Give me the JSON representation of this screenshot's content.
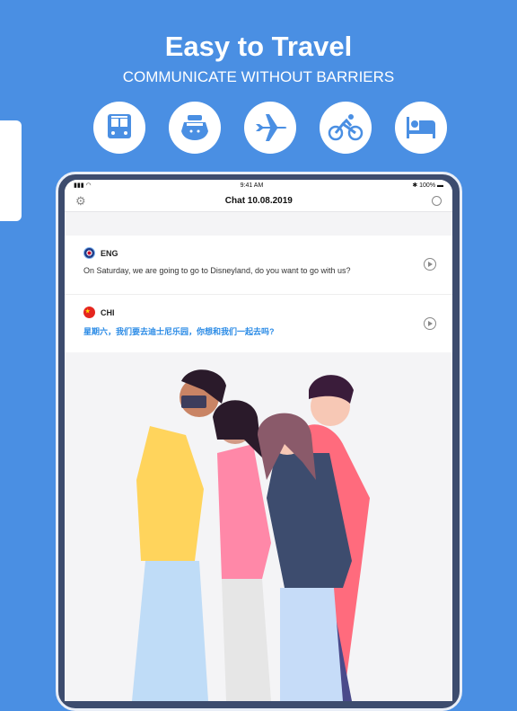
{
  "header": {
    "title": "Easy to Travel",
    "subtitle": "COMMUNICATE WITHOUT BARRIERS"
  },
  "categories": [
    "bus-icon",
    "ship-icon",
    "airplane-icon",
    "bicycle-icon",
    "bed-icon"
  ],
  "status_bar": {
    "time": "9:41 AM",
    "battery": "100%"
  },
  "nav": {
    "title": "Chat 10.08.2019"
  },
  "messages": [
    {
      "lang": "ENG",
      "text": "On Saturday, we are going to go to Disneyland, do you want to go with us?"
    },
    {
      "lang": "CHI",
      "text": "星期六，我们要去迪士尼乐园，你想和我们一起去吗?"
    }
  ],
  "colors": {
    "background": "#4a8fe3",
    "translation": "#2b8be6"
  }
}
